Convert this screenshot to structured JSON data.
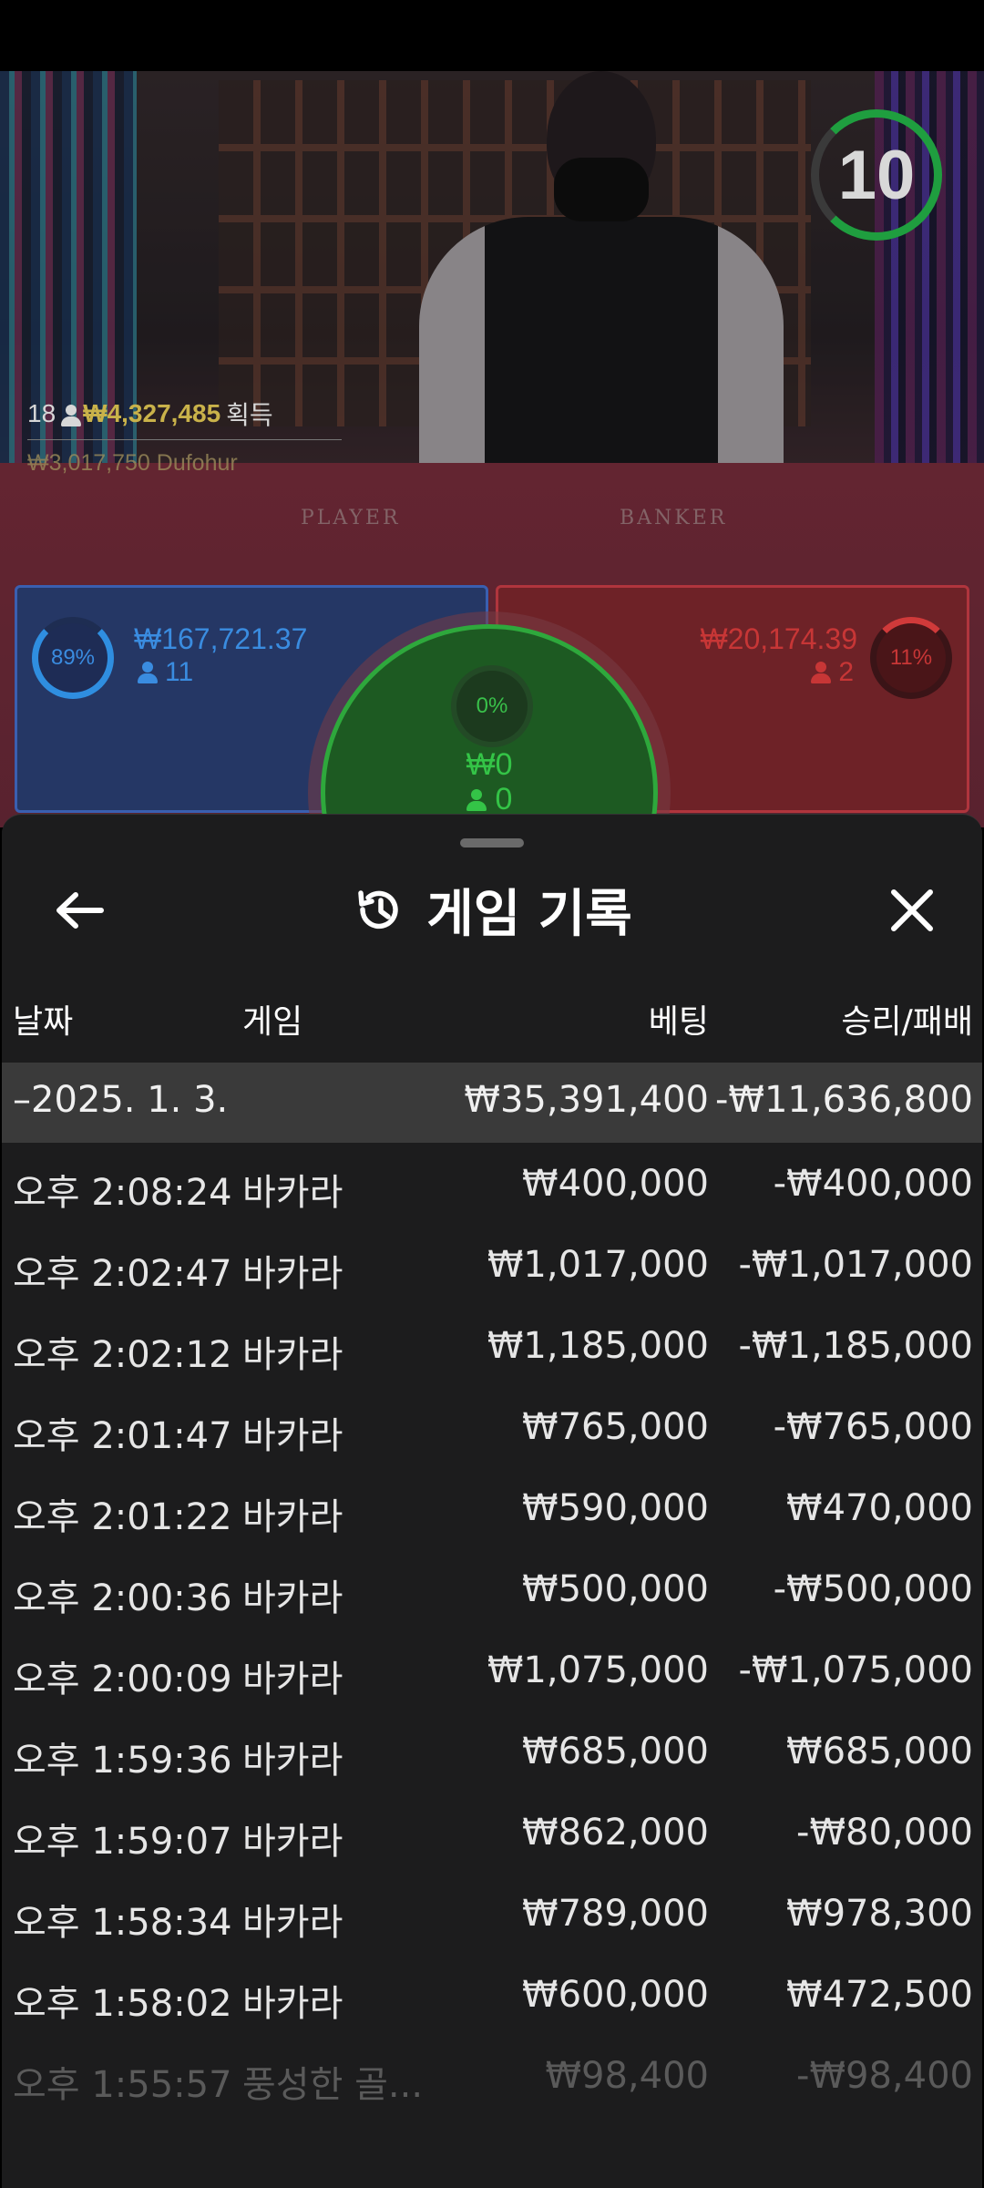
{
  "live": {
    "timer": "10",
    "winner": {
      "count": "18",
      "amount": "₩4,327,485",
      "suffix": "획득"
    },
    "winner_sub": "₩3,017,750  Dufohur",
    "felt_player": "PLAYER",
    "felt_banker": "BANKER",
    "player": {
      "percent": "89%",
      "amount": "₩167,721.37",
      "count": "11"
    },
    "tie": {
      "percent": "0%",
      "amount": "₩0",
      "count": "0"
    },
    "banker": {
      "percent": "11%",
      "amount": "₩20,174.39",
      "count": "2"
    }
  },
  "sheet": {
    "title": "게임 기록",
    "columns": {
      "date": "날짜",
      "game": "게임",
      "bet": "베팅",
      "result": "승리/패배"
    },
    "date_group": {
      "label": "–2025. 1. 3.",
      "bet": "₩35,391,400",
      "result": "-₩11,636,800"
    },
    "rows": [
      {
        "time": "오후 2:08:24",
        "game": "바카라",
        "bet": "₩400,000",
        "result": "-₩400,000"
      },
      {
        "time": "오후 2:02:47",
        "game": "바카라",
        "bet": "₩1,017,000",
        "result": "-₩1,017,000"
      },
      {
        "time": "오후 2:02:12",
        "game": "바카라",
        "bet": "₩1,185,000",
        "result": "-₩1,185,000"
      },
      {
        "time": "오후 2:01:47",
        "game": "바카라",
        "bet": "₩765,000",
        "result": "-₩765,000"
      },
      {
        "time": "오후 2:01:22",
        "game": "바카라",
        "bet": "₩590,000",
        "result": "₩470,000"
      },
      {
        "time": "오후 2:00:36",
        "game": "바카라",
        "bet": "₩500,000",
        "result": "-₩500,000"
      },
      {
        "time": "오후 2:00:09",
        "game": "바카라",
        "bet": "₩1,075,000",
        "result": "-₩1,075,000"
      },
      {
        "time": "오후 1:59:36",
        "game": "바카라",
        "bet": "₩685,000",
        "result": "₩685,000"
      },
      {
        "time": "오후 1:59:07",
        "game": "바카라",
        "bet": "₩862,000",
        "result": "-₩80,000"
      },
      {
        "time": "오후 1:58:34",
        "game": "바카라",
        "bet": "₩789,000",
        "result": "₩978,300"
      },
      {
        "time": "오후 1:58:02",
        "game": "바카라",
        "bet": "₩600,000",
        "result": "₩472,500"
      },
      {
        "time": "오후 1:55:57",
        "game": "풍성한 골...",
        "bet": "₩98,400",
        "result": "-₩98,400"
      }
    ]
  },
  "colors": {
    "player": "#3a8ce0",
    "banker": "#c73636",
    "tie": "#34c447",
    "timer": "#1f9e3f",
    "sheet_bg": "#1c1c1d",
    "date_row_bg": "#3a3a3a"
  }
}
